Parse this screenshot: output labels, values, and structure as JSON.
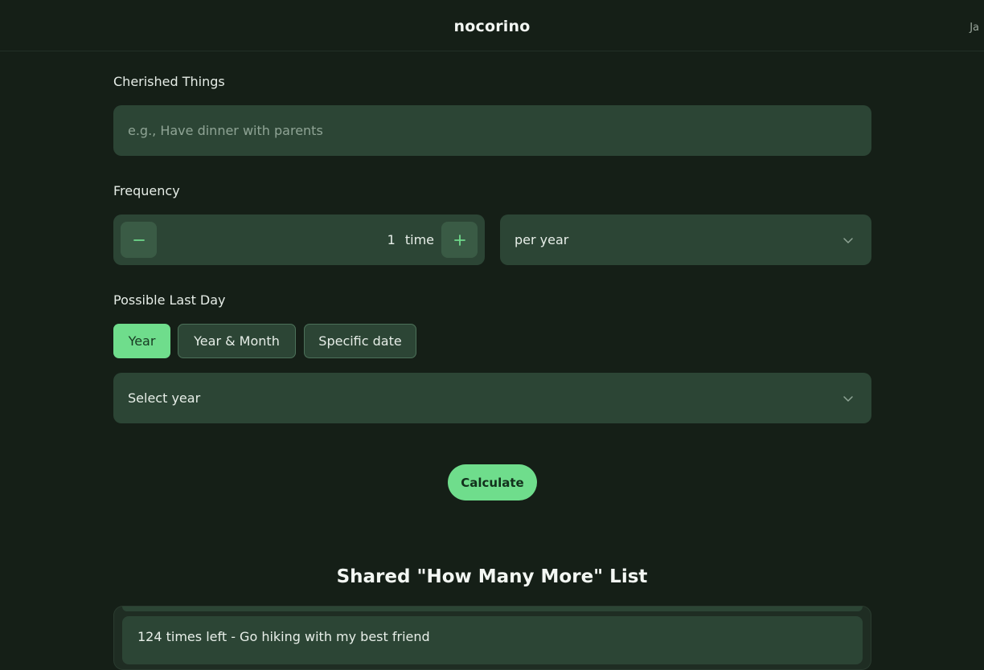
{
  "header": {
    "brand": "nocorino",
    "language": "Ja"
  },
  "form": {
    "cherished": {
      "label": "Cherished Things",
      "placeholder": "e.g., Have dinner with parents",
      "value": ""
    },
    "frequency": {
      "label": "Frequency",
      "count": "1",
      "unit": "time",
      "period": "per year"
    },
    "last_day": {
      "label": "Possible Last Day",
      "modes": [
        "Year",
        "Year & Month",
        "Specific date"
      ],
      "active_mode": "Year",
      "select_placeholder": "Select year"
    },
    "submit_label": "Calculate"
  },
  "shared": {
    "title": "Shared \"How Many More\" List",
    "items": [
      "124 times left - Go hiking with my best friend"
    ]
  },
  "colors": {
    "background": "#151f17",
    "field": "#2c4535",
    "accent": "#6fdd8c"
  },
  "icons": {
    "minus": "minus-icon",
    "plus": "plus-icon",
    "chevron": "chevron-down-icon"
  }
}
